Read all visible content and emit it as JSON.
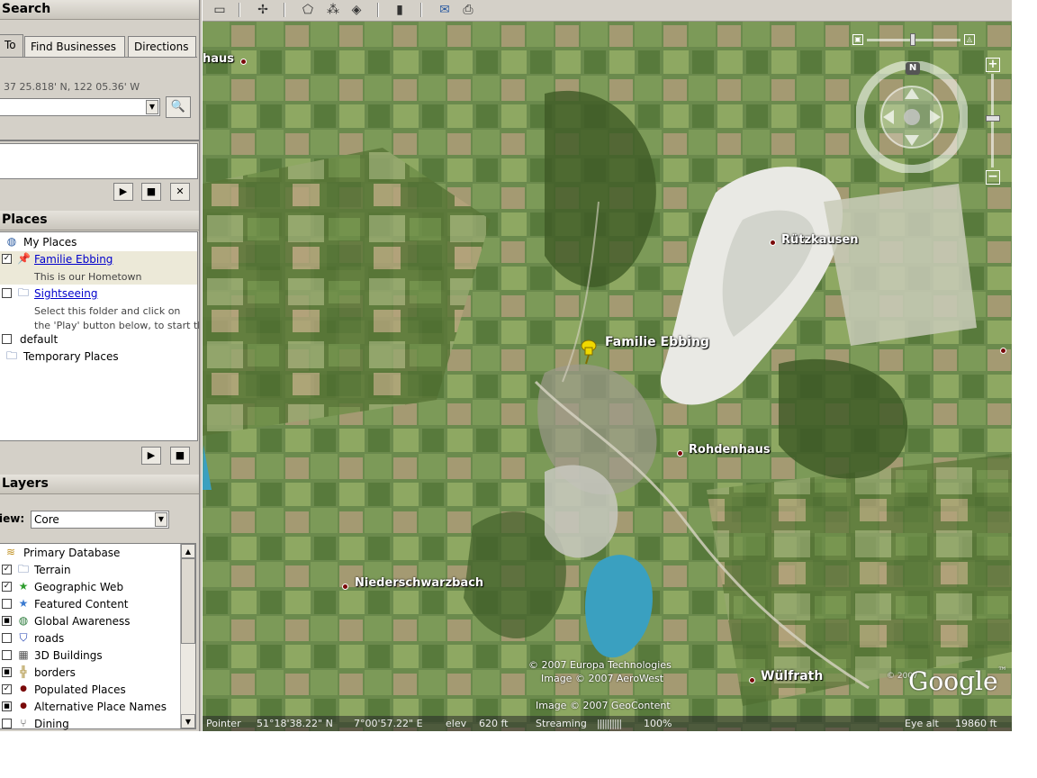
{
  "search": {
    "header": "Search",
    "tabs": [
      "To",
      "Find Businesses",
      "Directions"
    ],
    "coordinates_hint": "37 25.818' N, 122 05.36' W",
    "input_value": ""
  },
  "places": {
    "header": "Places",
    "items": [
      {
        "label": "My Places"
      },
      {
        "label": "Familie Ebbing",
        "desc": "This is our Hometown"
      },
      {
        "label": "Sightseeing",
        "desc1": "Select this folder and click on",
        "desc2": "the 'Play' button below, to start the"
      },
      {
        "label": "default"
      },
      {
        "label": "Temporary Places"
      }
    ]
  },
  "layers": {
    "header": "Layers",
    "view_label": "iew:",
    "view_value": "Core",
    "items": [
      {
        "label": "Primary Database"
      },
      {
        "label": "Terrain"
      },
      {
        "label": "Geographic Web"
      },
      {
        "label": "Featured Content"
      },
      {
        "label": "Global Awareness"
      },
      {
        "label": "roads"
      },
      {
        "label": "3D Buildings"
      },
      {
        "label": "borders"
      },
      {
        "label": "Populated Places"
      },
      {
        "label": "Alternative Place Names"
      },
      {
        "label": "Dining"
      }
    ]
  },
  "map": {
    "labels": {
      "haus": "haus",
      "ruetzkausen": "Rützkausen",
      "familie": "Familie Ebbing",
      "rohdenhaus": "Rohdenhaus",
      "niederschwarzbach": "Niederschwarzbach",
      "wuelfrath": "Wülfrath"
    },
    "credits": {
      "europa": "© 2007 Europa Technologies",
      "aerowest": "Image © 2007 AeroWest",
      "geocontent": "Image © 2007 GeoContent",
      "year": "© 2007"
    },
    "logo": "Google",
    "compass_n": "N"
  },
  "status": {
    "pointer_label": "Pointer",
    "lat": "51°18'38.22\" N",
    "lon": "7°00'57.22\" E",
    "elev_label": "elev",
    "elev_value": "620 ft",
    "streaming_label": "Streaming",
    "streaming_bar": "||||||||||",
    "streaming_pct": "100%",
    "eye_label": "Eye alt",
    "eye_value": "19860 ft"
  },
  "colors": {
    "panel": "#d4d0c8",
    "link": "#0000cc",
    "map_green": "#5e7a44"
  }
}
